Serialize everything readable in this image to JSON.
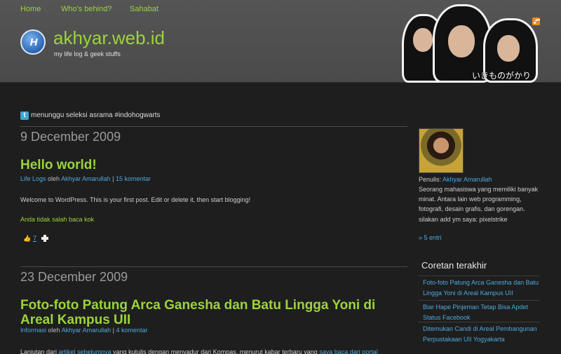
{
  "nav": {
    "items": [
      "Home",
      "Who's behind?",
      "Sahabat"
    ]
  },
  "site": {
    "logo_text": "H",
    "title": "akhyar.web.id",
    "tagline": "my life log & geek stuffs",
    "band_caption": "いきものがかり"
  },
  "twitter": {
    "status": "menunggu seleksi asrama #indohogwarts"
  },
  "posts": [
    {
      "date": "9 December 2009",
      "title": "Hello world!",
      "category": "Life Logs",
      "by": "oleh",
      "author": "Akhyar Amarullah",
      "comments": "15 komentar",
      "body": "Welcome to WordPress. This is your first post. Edit or delete it, then start blogging!",
      "extra_link": "Anda tidak salah baca kok",
      "share_count": "7"
    },
    {
      "date": "23 December 2009",
      "title": "Foto-foto Patung Arca Ganesha dan Batu Lingga Yoni di Areal Kampus UII",
      "category": "Informasi",
      "by": "oleh",
      "author": "Akhyar Amarullah",
      "comments": "4 komentar",
      "body_start": "Lanjutan dari ",
      "body_link1": "artikel sebelumnya",
      "body_mid": " yang kutulis dengan menyadur dari Kompas, menurut kabar terbaru yang ",
      "body_link2": "saya baca dari portal"
    }
  ],
  "sidebar": {
    "author_prefix": "Penulis: ",
    "author_name": "Akhyar Amarullah",
    "bio": "Seorang mahasiswa yang memiliki banyak minat. Antara lain web programming, fotografi, desain grafis, dan gorengan. silakan add ym saya: pixelstrike",
    "entries": "» 5 entri",
    "recent_title": "Coretan terakhir",
    "recent": [
      "Foto-foto Patung Arca Ganesha dan Batu Lingga Yoni di Areal Kampus UII",
      "Biar Hape Pinjeman Tetap Bisa Apdet Status Facebook",
      "Ditemukan Candi di Areal Pembangunan Perpustakaan UII Yogyakarta"
    ]
  }
}
